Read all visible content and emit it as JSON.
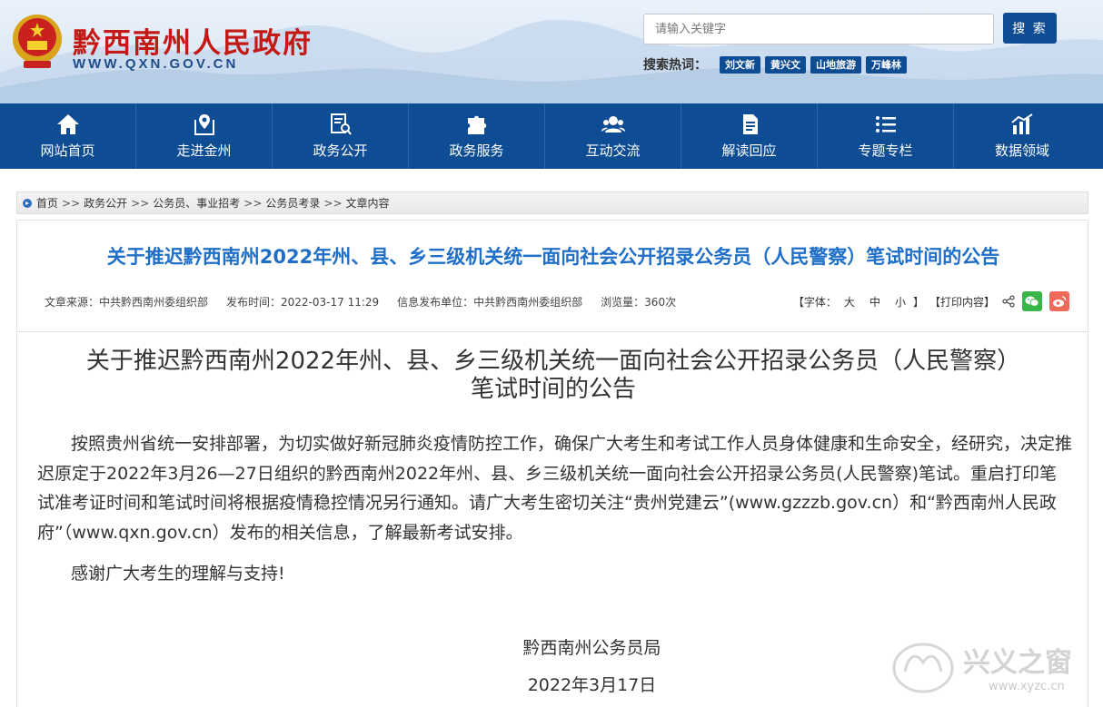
{
  "header": {
    "site_name": "黔西南州人民政府",
    "site_url": "WWW.QXN.GOV.CN",
    "search_placeholder": "请输入关键字",
    "search_button": "搜 索",
    "hot_label": "搜索热词：",
    "hot_tags": [
      "刘文新",
      "黄兴文",
      "山地旅游",
      "万峰林"
    ]
  },
  "nav": [
    {
      "label": "网站首页",
      "icon": "home-icon"
    },
    {
      "label": "走进金州",
      "icon": "map-pin-icon"
    },
    {
      "label": "政务公开",
      "icon": "document-search-icon"
    },
    {
      "label": "政务服务",
      "icon": "puzzle-icon"
    },
    {
      "label": "互动交流",
      "icon": "users-icon"
    },
    {
      "label": "解读回应",
      "icon": "file-icon"
    },
    {
      "label": "专题专栏",
      "icon": "list-icon"
    },
    {
      "label": "数据领域",
      "icon": "chart-icon"
    }
  ],
  "breadcrumb": [
    "首页",
    "政务公开",
    "公务员、事业招考",
    "公务员考录",
    "文章内容"
  ],
  "breadcrumb_sep": ">>",
  "article": {
    "title": "关于推迟黔西南州2022年州、县、乡三级机关统一面向社会公开招录公务员（人民警察）笔试时间的公告",
    "meta": {
      "source": "文章来源：中共黔西南州委组织部",
      "date": "发布时间：2022-03-17 11:29",
      "publisher": "信息发布单位：中共黔西南州委组织部",
      "views": "浏览量：360次"
    },
    "tools": {
      "font_label": "【字体：",
      "font_large": "大",
      "font_medium": "中",
      "font_small": "小",
      "font_end": "】",
      "print": "【打印内容】"
    },
    "body_title_line1": "关于推迟黔西南州2022年州、县、乡三级机关统一面向社会公开招录公务员（人民警察）",
    "body_title_line2": "笔试时间的公告",
    "paragraph1": "按照贵州省统一安排部署，为切实做好新冠肺炎疫情防控工作，确保广大考生和考试工作人员身体健康和生命安全，经研究，决定推迟原定于2022年3月26—27日组织的黔西南州2022年州、县、乡三级机关统一面向社会公开招录公务员(人民警察)笔试。重启打印笔试准考证时间和笔试时间将根据疫情稳控情况另行通知。请广大考生密切关注“贵州党建云”(www.gzzzb.gov.cn）和“黔西南州人民政府”（www.qxn.gov.cn）发布的相关信息，了解最新考试安排。",
    "paragraph2": "感谢广大考生的理解与支持!",
    "signature_org": "黔西南州公务员局",
    "signature_date": "2022年3月17日"
  },
  "watermark": {
    "text": "兴义之窗",
    "url": "www.xyzc.cn"
  },
  "colors": {
    "nav_bg": "#0e4c93",
    "title_blue": "#1f6fc9",
    "brand_red": "#c41a16"
  }
}
